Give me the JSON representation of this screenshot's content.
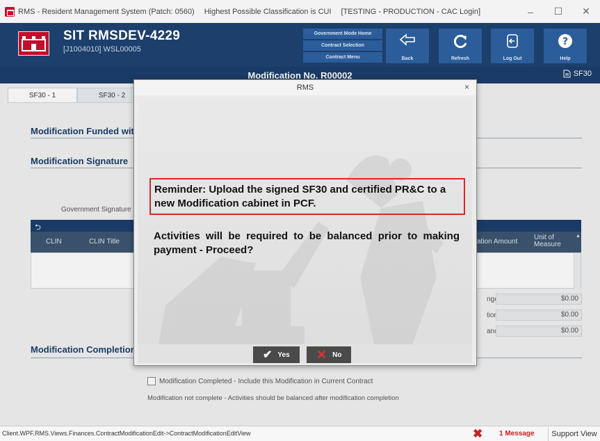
{
  "window": {
    "title": "RMS - Resident Management System (Patch: 0560)",
    "classification": "Highest Possible Classification is CUI",
    "environment": "[TESTING - PRODUCTION - CAC Login]",
    "minimize": "–",
    "maximize": "☐",
    "close": "✕"
  },
  "header": {
    "system_name": "SIT RMSDEV-4229",
    "system_sub": "[J1004010] WSL00005",
    "gov_menu": [
      "Government Mode Home",
      "Contract Selection",
      "Contract Menu"
    ],
    "buttons": {
      "back": "Back",
      "refresh": "Refresh",
      "logout": "Log Out",
      "help": "Help"
    }
  },
  "page": {
    "modification_title": "Modification No. R00002",
    "sf30_link": "SF30",
    "tabs": [
      "SF30 - 1",
      "SF30 - 2"
    ],
    "sections": {
      "funded": "Modification Funded wit",
      "signature": "Modification Signature",
      "completion": "Modification Completion"
    },
    "gov_signature_label": "Government Signature D",
    "grid": {
      "columns": {
        "clin": "CLIN",
        "clin_title": "CLIN Title",
        "mod_amount": "ation Amount",
        "unit": "Unit of Measure"
      }
    },
    "totals": [
      {
        "label": "nges",
        "value": "$0.00"
      },
      {
        "label": "tions",
        "value": "$0.00"
      },
      {
        "label": "ance",
        "value": "$0.00"
      }
    ],
    "completed_checkbox": "Modification Completed - Include this Modification in Current Contract",
    "incomplete_note": "Modification not complete - Activities should be balanced after modification completion"
  },
  "modal": {
    "title": "RMS",
    "close": "×",
    "reminder": "Reminder: Upload the signed SF30 and certified PR&C to a new Modification cabinet in PCF.",
    "question": "Activities will be required to be balanced prior to making payment - Proceed?",
    "yes_label": "Yes",
    "no_label": "No"
  },
  "status_bar": {
    "view_path": "Client.WPF.RMS.Views.Finances.ContractModificationEdit->ContractModificationEditView",
    "message_count": "1 Message",
    "support_view": "Support View"
  }
}
